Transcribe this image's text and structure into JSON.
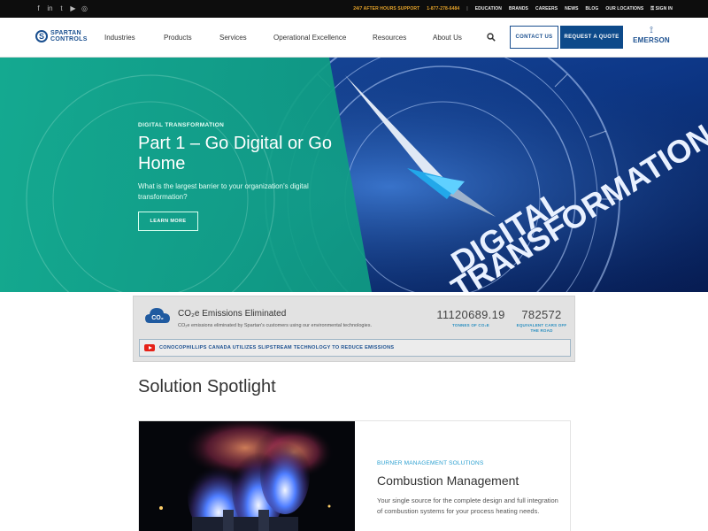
{
  "topbar": {
    "social": [
      "f",
      "in",
      "t",
      "▶",
      "◎"
    ],
    "support": "24/7 AFTER HOURS SUPPORT",
    "phone": "1-877-278-6484",
    "sep": "|",
    "links": [
      "EDUCATION",
      "BRANDS",
      "CAREERS",
      "NEWS",
      "BLOG",
      "OUR LOCATIONS",
      "SIGN IN"
    ]
  },
  "header": {
    "logo_line1": "SPARTAN",
    "logo_line2": "CONTROLS",
    "nav": [
      "Industries",
      "Products",
      "Services",
      "Operational Excellence",
      "Resources",
      "About Us"
    ],
    "contact": "CONTACT US",
    "quote": "REQUEST A QUOTE",
    "emerson": "EMERSON"
  },
  "hero": {
    "eyebrow": "DIGITAL TRANSFORMATION",
    "title": "Part 1 – Go Digital or Go Home",
    "subtitle": "What is the largest barrier to your organization's digital transformation?",
    "button": "LEARN MORE",
    "graphic_line1": "DIGITAL",
    "graphic_line2": "TRANSFORMATION"
  },
  "emissions": {
    "badge": "CO₂",
    "title": "CO₂e Emissions Eliminated",
    "description": "CO₂e emissions eliminated by Spartan's customers using our environmental technologies.",
    "stat1_value": "11120689.19",
    "stat1_label": "TONNES OF CO₂E",
    "stat2_value": "782572",
    "stat2_label": "EQUIVALENT CARS OFF THE ROAD",
    "link_text": "CONOCOPHILLIPS CANADA UTILIZES SLIPSTREAM TECHNOLOGY TO REDUCE EMISSIONS"
  },
  "spotlight": {
    "heading": "Solution Spotlight",
    "category": "BURNER MANAGEMENT SOLUTIONS",
    "title": "Combustion Management",
    "description": "Your single source for the complete design and full integration of combustion systems for your process heating needs."
  },
  "colors": {
    "brand": "#1a4f8f",
    "teal": "#13a98a",
    "support": "#e8a52a",
    "accent": "#2a9fd0"
  }
}
